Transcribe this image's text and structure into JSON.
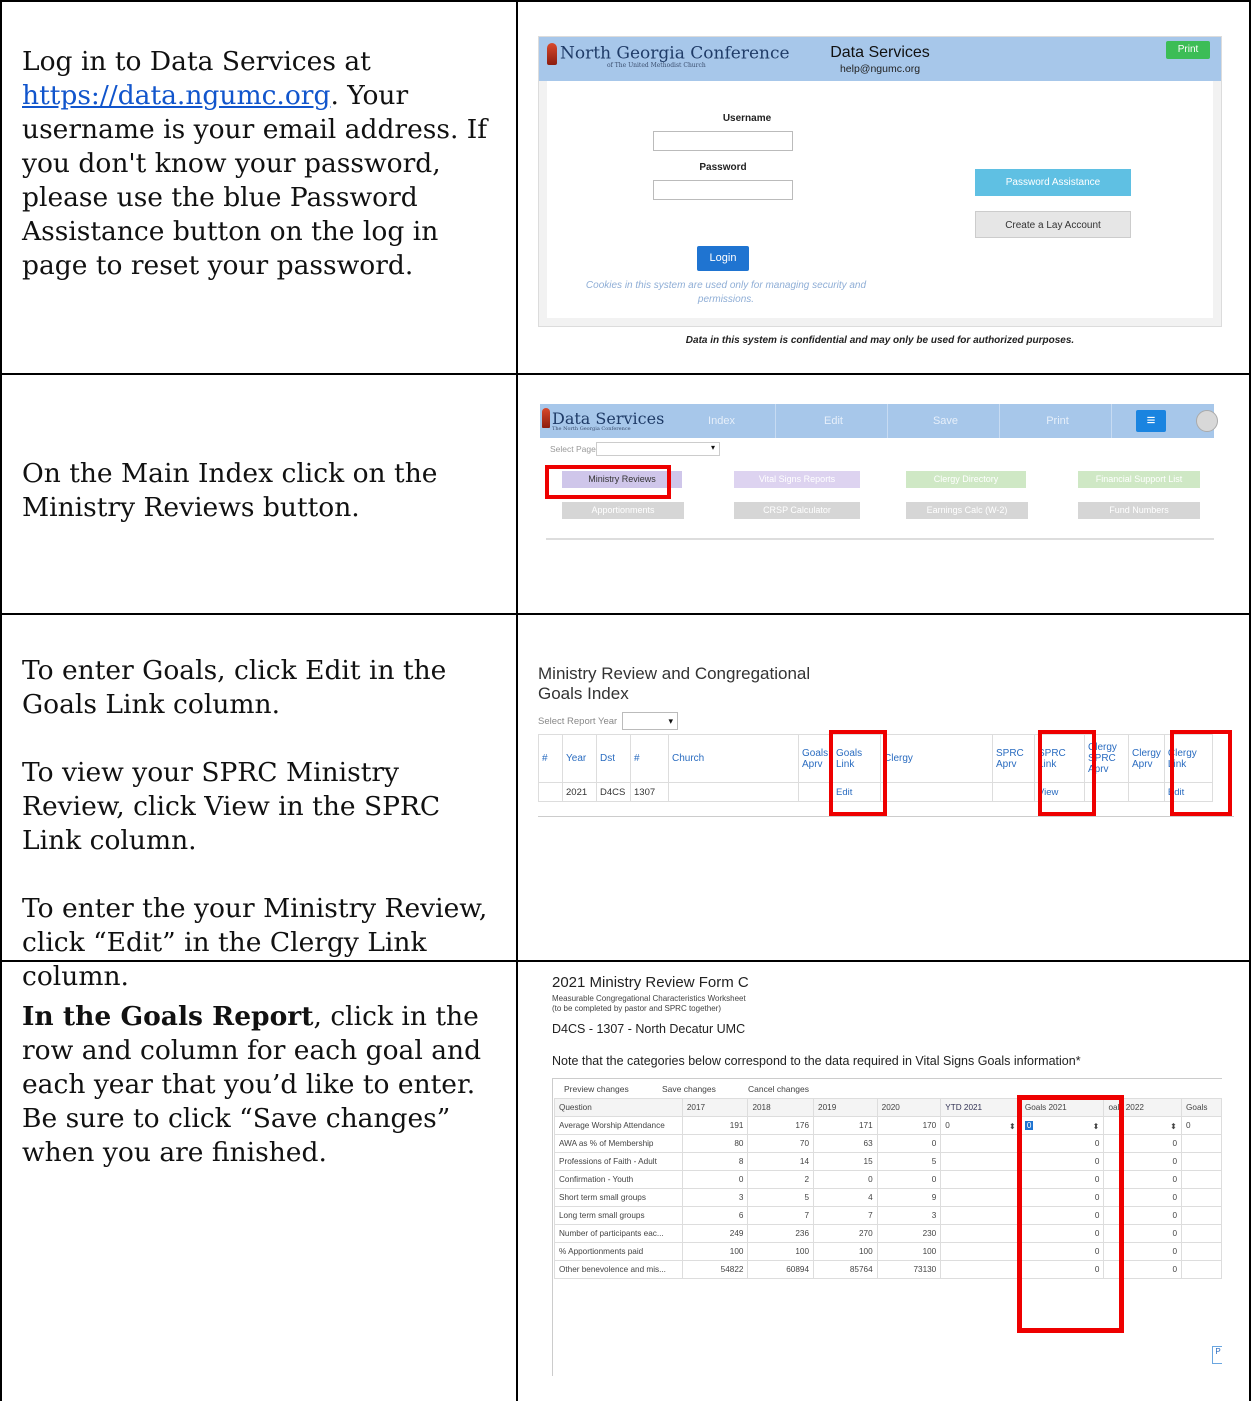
{
  "steps": [
    {
      "text_before_link": "Log in to Data Services at ",
      "link": "https://data.ngumc.org",
      "text_after_link": ". Your username is your email address. If you don't know your password, please use the blue Password Assistance button on the log in page to reset your password."
    },
    {
      "text": "On the Main Index click on the Ministry Reviews button."
    },
    {
      "paragraphs": [
        "To enter Goals, click Edit in the Goals Link column.",
        "To view your SPRC Ministry Review, click View in the SPRC Link column.",
        "To enter the your Ministry Review, click “Edit” in the Clergy Link column."
      ]
    },
    {
      "bold": "In the Goals Report",
      "rest": ", click in the row and column for each goal and each year that you’d like to enter. Be sure to click “Save changes” when you are finished."
    }
  ],
  "login_screen": {
    "logo_text": "North Georgia Conference",
    "logo_subtext": "of The United Methodist Church",
    "title": "Data Services",
    "email": "help@ngumc.org",
    "print_label": "Print",
    "username_label": "Username",
    "password_label": "Password",
    "login_label": "Login",
    "cookies_note": "Cookies in this system are used only for managing security and permissions.",
    "password_assistance_label": "Password Assistance",
    "create_lay_label": "Create a Lay Account",
    "confidential_note": "Data in this system is confidential and may only be used for authorized purposes."
  },
  "main_index": {
    "title": "Data Services",
    "subtitle": "The North Georgia Conference",
    "nav": [
      "Index",
      "Edit",
      "Save",
      "Print"
    ],
    "menu_icon": "hamburger-icon",
    "select_page_label": "Select Page",
    "select_arrow": "▾",
    "tiles_row1": [
      "Ministry Reviews",
      "Vital Signs Reports",
      "Clergy Directory",
      "Financial Support List"
    ],
    "tiles_row2": [
      "Apportionments",
      "CRSP Calculator",
      "Earnings Calc (W-2)",
      "Fund Numbers"
    ],
    "colors": {
      "ministry": "#cfc6ea",
      "vital": "#ddd3f0",
      "clergy": "#cfe8c5",
      "financial": "#cfe8c5",
      "gray": "#d6d6d6",
      "bar": "#a7c7ea"
    }
  },
  "review_index": {
    "title_line1": "Ministry Review and Congregational",
    "title_line2": "Goals Index",
    "select_year_label": "Select Report Year",
    "select_arrow": "▾",
    "headers": [
      "#",
      "Year",
      "Dst",
      "#",
      "Church",
      "Goals Aprv",
      "Goals Link",
      "Clergy",
      "SPRC Aprv",
      "SPRC Link",
      "Clergy SPRC Aprv",
      "Clergy Aprv",
      "Clergy Link"
    ],
    "row": [
      "",
      "2021",
      "D4CS",
      "1307",
      "",
      "",
      "Edit",
      "",
      "",
      "View",
      "",
      "",
      "Edit"
    ]
  },
  "form_c": {
    "title": "2021 Ministry Review Form C",
    "subtitle1": "Measurable Congregational Characteristics Worksheet",
    "subtitle2": "(to be completed by pastor and SPRC together)",
    "church": "D4CS - 1307 - North Decatur UMC",
    "note": "Note that the categories below correspond to the data required in Vital Signs Goals information*",
    "toolbar": [
      "Preview changes",
      "Save changes",
      "Cancel changes"
    ],
    "columns": [
      "Question",
      "2017",
      "2018",
      "2019",
      "2020",
      "YTD 2021",
      "Goals 2021",
      "oals 2022",
      "Goals"
    ],
    "rows": [
      {
        "q": "Average Worship Attendance",
        "v": [
          "191",
          "176",
          "171",
          "170"
        ],
        "ytd": "0",
        "g21": "0",
        "g22": "",
        "g23": "0"
      },
      {
        "q": "AWA as % of Membership",
        "v": [
          "80",
          "70",
          "63",
          "0"
        ],
        "ytd": "",
        "g21": "0",
        "g22": "0",
        "g23": ""
      },
      {
        "q": "Professions of Faith - Adult",
        "v": [
          "8",
          "14",
          "15",
          "5"
        ],
        "ytd": "",
        "g21": "0",
        "g22": "0",
        "g23": ""
      },
      {
        "q": "Confirmation - Youth",
        "v": [
          "0",
          "2",
          "0",
          "0"
        ],
        "ytd": "",
        "g21": "0",
        "g22": "0",
        "g23": ""
      },
      {
        "q": "Short term small groups",
        "v": [
          "3",
          "5",
          "4",
          "9"
        ],
        "ytd": "",
        "g21": "0",
        "g22": "0",
        "g23": ""
      },
      {
        "q": "Long term small groups",
        "v": [
          "6",
          "7",
          "7",
          "3"
        ],
        "ytd": "",
        "g21": "0",
        "g22": "0",
        "g23": ""
      },
      {
        "q": "Number of participants eac...",
        "v": [
          "249",
          "236",
          "270",
          "230"
        ],
        "ytd": "",
        "g21": "0",
        "g22": "0",
        "g23": ""
      },
      {
        "q": "% Apportionments paid",
        "v": [
          "100",
          "100",
          "100",
          "100"
        ],
        "ytd": "",
        "g21": "0",
        "g22": "0",
        "g23": ""
      },
      {
        "q": "Other benevolence and mis...",
        "v": [
          "54822",
          "60894",
          "85764",
          "73130"
        ],
        "ytd": "",
        "g21": "0",
        "g22": "0",
        "g23": ""
      }
    ],
    "spin_glyph": "⬍",
    "page_button": "P"
  }
}
